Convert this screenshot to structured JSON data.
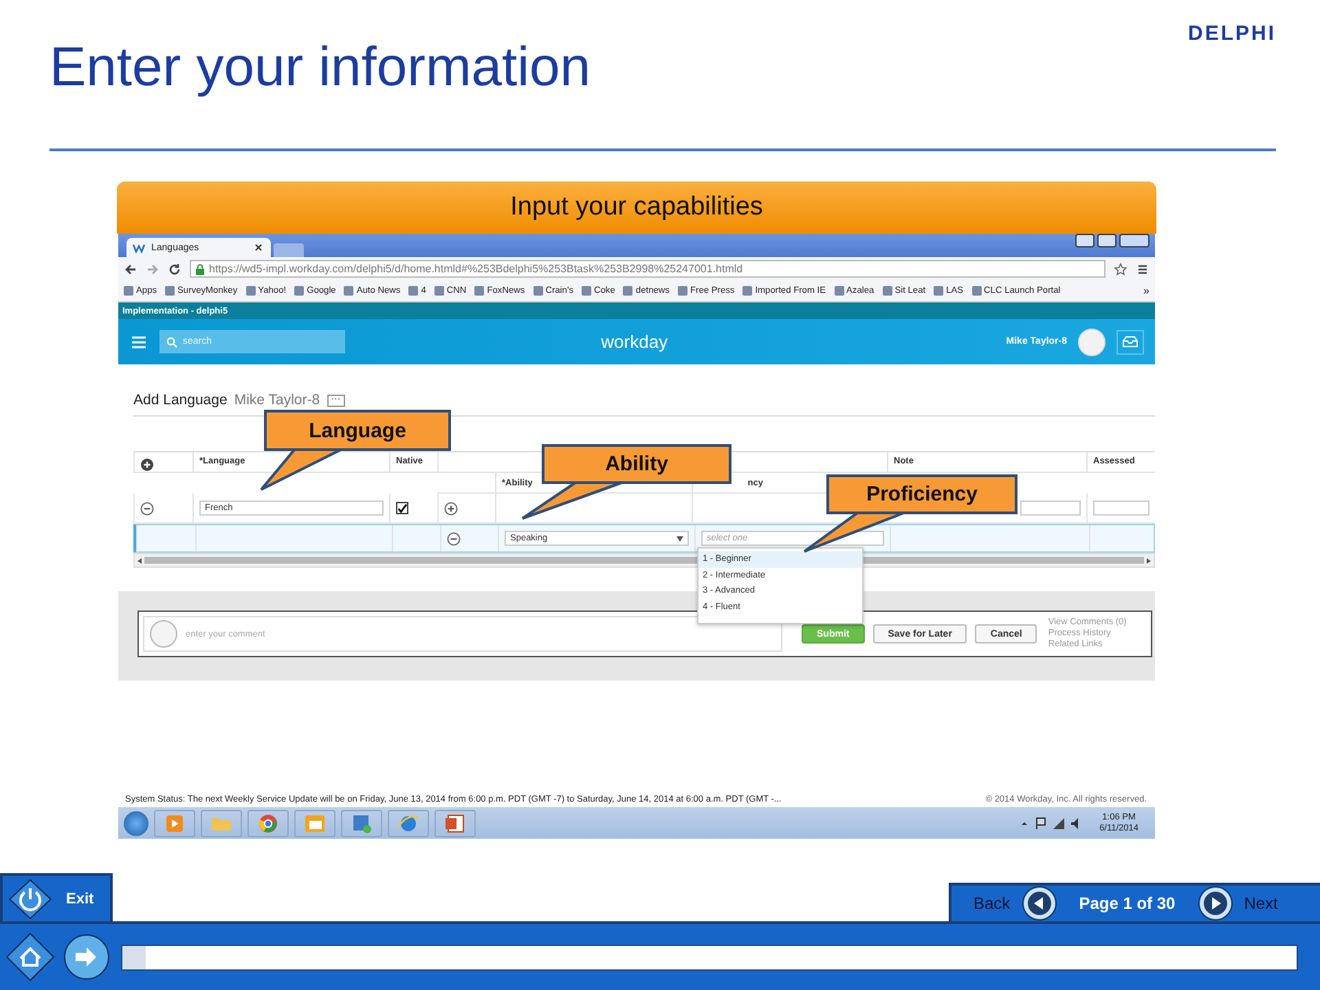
{
  "slide": {
    "title": "Enter your information",
    "logo": "DELPHI",
    "banner": "Input your capabilities"
  },
  "browser": {
    "tab_title": "Languages",
    "url": "https://wd5-impl.workday.com/delphi5/d/home.htmld#%253Bdelphi5%253Btask%253B2998%25247001.htmld",
    "bookmarks": [
      "Apps",
      "SurveyMonkey",
      "Yahoo!",
      "Google",
      "Auto News",
      "4",
      "CNN",
      "FoxNews",
      "Crain's",
      "Coke",
      "detnews",
      "Free Press",
      "Imported From IE",
      "Azalea",
      "Sit Leat",
      "LAS",
      "CLC Launch Portal"
    ],
    "more": "»"
  },
  "app": {
    "tenant": "Implementation - delphi5",
    "search": {
      "placeholder": "search"
    },
    "logo": "workday",
    "user": "Mike Taylor-8"
  },
  "page": {
    "heading": "Add Language",
    "subject": "Mike Taylor-8",
    "more": "···"
  },
  "table": {
    "columns": [
      "*Language",
      "Native",
      "Note",
      "Assessed"
    ],
    "subcolumns": [
      "*Ability",
      "ncy"
    ],
    "rows": [
      {
        "kind": "language",
        "language": "French",
        "native": true,
        "selected": false
      },
      {
        "kind": "ability",
        "ability": "Speaking",
        "proficiency": {
          "placeholder": "select one"
        },
        "selected": true
      }
    ]
  },
  "dropdown": {
    "options": [
      {
        "label": "1 - Beginner",
        "selected": true
      },
      {
        "label": "2 - Intermediate",
        "selected": false
      },
      {
        "label": "3 - Advanced",
        "selected": false
      },
      {
        "label": "4 - Fluent",
        "selected": false
      }
    ]
  },
  "footer": {
    "comment": {
      "placeholder": "enter your comment"
    },
    "buttons": [
      "Submit",
      "Save for Later",
      "Cancel"
    ],
    "links": [
      "View Comments (0)",
      "Process History",
      "Related Links"
    ]
  },
  "status": {
    "message": "System Status: The next Weekly Service Update will be on Friday, June 13, 2014 from 6:00 p.m. PDT (GMT -7) to Saturday, June 14, 2014 at 6:00 a.m. PDT (GMT -...",
    "copyright": "© 2014 Workday, Inc. All rights reserved."
  },
  "taskbar": {
    "time": "1:06 PM",
    "date": "6/11/2014"
  },
  "callouts": [
    "Language",
    "Ability",
    "Proficiency"
  ],
  "player": {
    "exit": "Exit",
    "back": "Back",
    "page": "Page 1 of 30",
    "next": "Next",
    "progress": {
      "level": 0.02
    }
  }
}
